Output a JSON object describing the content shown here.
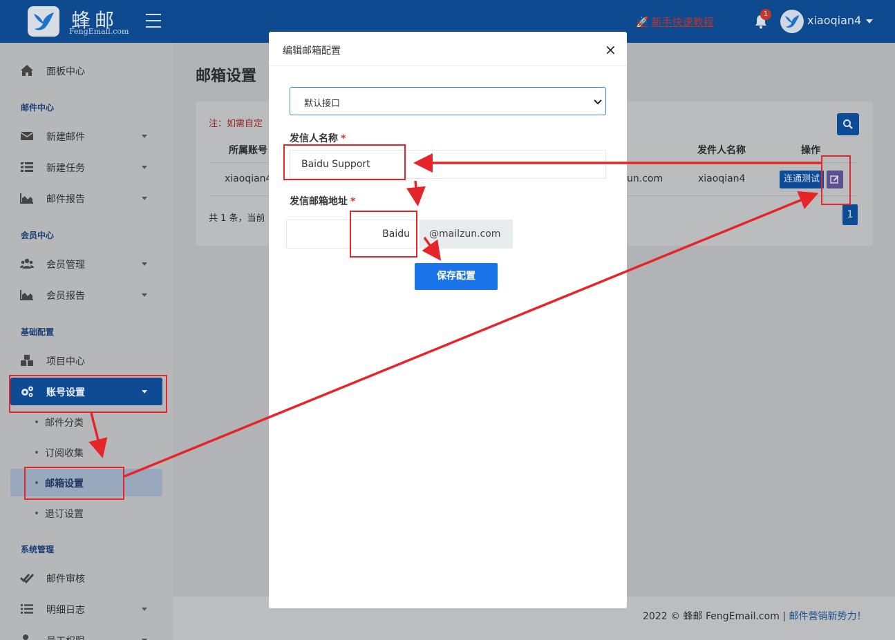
{
  "header": {
    "logo_text": "蜂邮",
    "logo_sub": "FengEmail.com",
    "tutorial": "新手快速教程",
    "notif_count": "1",
    "username": "xiaoqian4"
  },
  "sidebar": {
    "dashboard": "面板中心",
    "sections": {
      "mail": "邮件中心",
      "member": "会员中心",
      "base": "基础配置",
      "system": "系统管理"
    },
    "items": {
      "new_mail": "新建邮件",
      "new_task": "新建任务",
      "mail_report": "邮件报告",
      "member_manage": "会员管理",
      "member_report": "会员报告",
      "project": "项目中心",
      "account": "账号设置",
      "mail_category": "邮件分类",
      "subscribe": "订阅收集",
      "mailbox_settings": "邮箱设置",
      "unsubscribe": "退订设置",
      "mail_review": "邮件审核",
      "detail_log": "明细日志",
      "staff": "员工权限"
    }
  },
  "main": {
    "page_title": "邮箱设置",
    "note": "注：如需自定",
    "table": {
      "headers": {
        "account": "所属账号",
        "sender_name": "发件人名称",
        "actions": "操作"
      },
      "row": {
        "account": "xiaoqian4",
        "domain": "un.com",
        "sender_name": "xiaoqian4",
        "test_btn": "连通测试"
      }
    },
    "total": "共 1 条，当前",
    "page": "1"
  },
  "footer": {
    "copyright": "2022 © 蜂邮 FengEmail.com | ",
    "slogan": "邮件营销新势力！"
  },
  "modal": {
    "title": "编辑邮箱配置",
    "close": "×",
    "interface_select": "默认接口",
    "sender_name_label": "发信人名称",
    "sender_name_value": "Baidu Support",
    "sender_email_label": "发信邮箱地址",
    "sender_email_value": "Baidu",
    "email_suffix": "@mailzun.com",
    "required_mark": "*",
    "save_btn": "保存配置"
  },
  "colors": {
    "topbar": "#0e4a8f",
    "primary": "#1a73e8",
    "annotation": "#e5252a"
  }
}
